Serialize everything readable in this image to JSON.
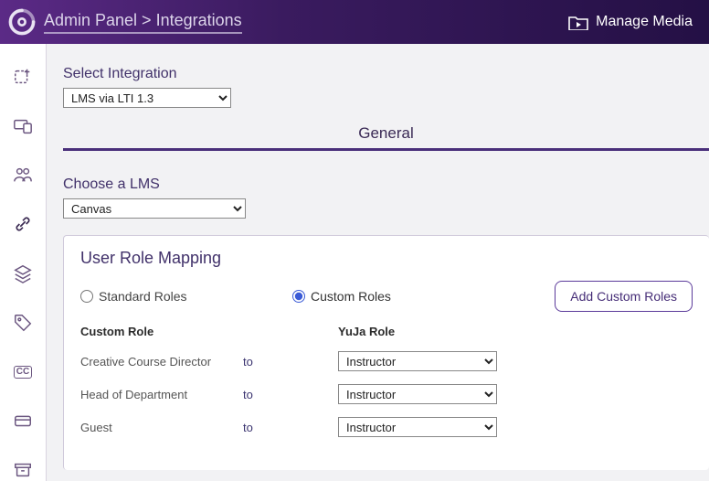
{
  "header": {
    "breadcrumb": "Admin Panel > Integrations",
    "manage_media": "Manage Media"
  },
  "integration": {
    "label": "Select Integration",
    "selected": "LMS via LTI 1.3"
  },
  "tab": {
    "label": "General"
  },
  "lms": {
    "label": "Choose a LMS",
    "selected": "Canvas"
  },
  "role_mapping": {
    "title": "User Role Mapping",
    "radio_standard": "Standard Roles",
    "radio_custom": "Custom Roles",
    "radio_selected": "custom",
    "add_button": "Add Custom Roles",
    "col_custom_role": "Custom Role",
    "col_yuja_role": "YuJa Role",
    "to_label": "to",
    "rows": [
      {
        "custom_role": "Creative Course Director",
        "yuja_role": "Instructor"
      },
      {
        "custom_role": "Head of Department",
        "yuja_role": "Instructor"
      },
      {
        "custom_role": "Guest",
        "yuja_role": "Instructor"
      }
    ]
  }
}
